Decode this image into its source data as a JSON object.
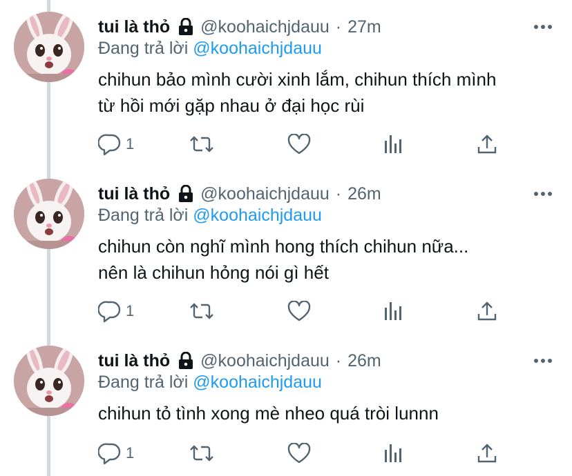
{
  "tweets": [
    {
      "name": "tui là thỏ",
      "handle": "@koohaichjdauu",
      "separator": "·",
      "time": "27m",
      "reply_prefix": "Đang trả lời",
      "reply_to": "@koohaichjdauu",
      "text_lines": [
        "chihun bảo mình cười xinh lắm, chihun thích mình",
        "từ hồi mới gặp nhau ở đại học rùi"
      ],
      "reply_count": "1"
    },
    {
      "name": "tui là thỏ",
      "handle": "@koohaichjdauu",
      "separator": "·",
      "time": "26m",
      "reply_prefix": "Đang trả lời",
      "reply_to": "@koohaichjdauu",
      "text_lines": [
        "chihun còn nghĩ mình hong thích chihun nữa...",
        "nên là chihun hỏng nói gì hết"
      ],
      "reply_count": "1"
    },
    {
      "name": "tui là thỏ",
      "handle": "@koohaichjdauu",
      "separator": "·",
      "time": "26m",
      "reply_prefix": "Đang trả lời",
      "reply_to": "@koohaichjdauu",
      "text_lines": [
        "chihun tỏ tình xong mè nheo quá tròi lunnn"
      ],
      "reply_count": "1"
    }
  ],
  "icons": [
    "lock-icon",
    "more-icon",
    "reply-icon",
    "retweet-icon",
    "like-icon",
    "views-icon",
    "share-icon"
  ],
  "colors": {
    "text": "#0f1419",
    "secondary": "#536471",
    "link": "#1d9bf0",
    "thread_line": "#cfd9de"
  }
}
